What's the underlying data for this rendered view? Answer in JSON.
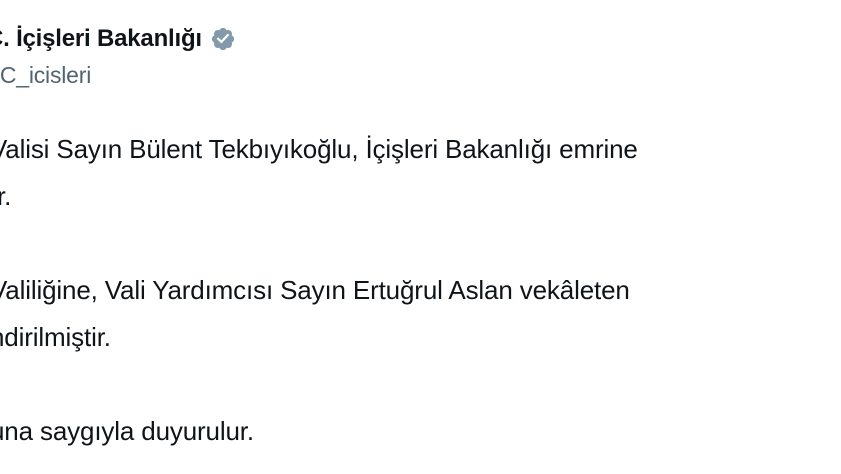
{
  "account": {
    "display_name": "C. İçişleri Bakanlığı",
    "handle": "TC_icisleri",
    "verified_icon": "verified-badge-icon",
    "verified_color": "#829aab"
  },
  "tweet": {
    "lines": [
      "Valisi Sayın Bülent Tekbıyıkoğlu, İçişleri Bakanlığı emrine",
      "ır.",
      "",
      "Valiliğine, Vali Yardımcısı Sayın Ertuğrul Aslan vekâleten",
      "ndirilmiştir.",
      "",
      "una saygıyla duyurulur."
    ]
  }
}
